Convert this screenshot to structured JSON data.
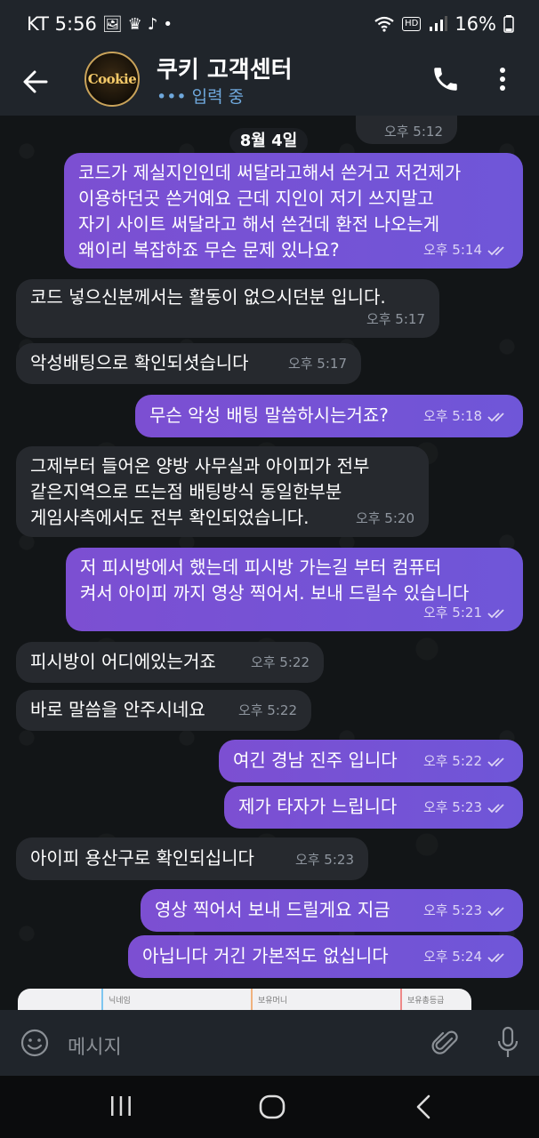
{
  "status_bar": {
    "carrier_time": "KT 5:56",
    "hd": "HD",
    "battery": "16%"
  },
  "header": {
    "avatar_text": "Cookie",
    "title": "쿠키 고객센터",
    "subtitle": "••• 입력 중"
  },
  "chat": {
    "prev_time": "오후 5:12",
    "date": "8월 4일",
    "messages": [
      {
        "dir": "out",
        "text": "코드가 제실지인인데 써달라고해서 쓴거고 저건제가\n이용하던곳 쓴거예요 근데 지인이 저기 쓰지말고\n자기 사이트 써달라고 해서 쓴건데 환전 나오는게\n왜이리 복잡하죠 무슨 문제 있나요?",
        "time": "오후 5:14"
      },
      {
        "dir": "in",
        "text": "코드 넣으신분께서는 활동이 없으시던분 입니다.",
        "time": "오후 5:17"
      },
      {
        "dir": "in",
        "text": "악성배팅으로 확인되셧습니다",
        "time": "오후 5:17"
      },
      {
        "dir": "out",
        "text": "무슨 악성 배팅 말씀하시는거죠?",
        "time": "오후 5:18"
      },
      {
        "dir": "in",
        "text": "그제부터 들어온 양방 사무실과 아이피가 전부\n같은지역으로 뜨는점 배팅방식 동일한부분\n게임사측에서도 전부 확인되었습니다.",
        "time": "오후 5:20"
      },
      {
        "dir": "out",
        "text": "저 피시방에서 했는데 피시방 가는길 부터 컴퓨터\n켜서 아이피 까지 영상 찍어서. 보내 드릴수 있습니다",
        "time": "오후 5:21"
      },
      {
        "dir": "in",
        "text": "피시방이 어디에있는거죠",
        "time": "오후 5:22"
      },
      {
        "dir": "in",
        "text": "바로 말씀을 안주시네요",
        "time": "오후 5:22"
      },
      {
        "dir": "out",
        "text": "여긴 경남 진주 입니다",
        "time": "오후 5:22"
      },
      {
        "dir": "out",
        "text": "제가 타자가 느립니다",
        "time": "오후 5:23"
      },
      {
        "dir": "in",
        "text": "아이피 용산구로 확인되십니다",
        "time": "오후 5:23"
      },
      {
        "dir": "out",
        "text": "영상 찍어서 보내 드릴게요 지금",
        "time": "오후 5:23"
      },
      {
        "dir": "out",
        "text": "아닙니다 거긴 가본적도 없십니다",
        "time": "오후 5:24"
      }
    ],
    "preview_labels": [
      "닉네임",
      "보유머니",
      "보유총등급"
    ]
  },
  "input": {
    "placeholder": "메시지"
  },
  "colors": {
    "outgoing_bubble": "#7a4fd0",
    "incoming_bubble": "#26292e",
    "bar_bg": "#20252b",
    "accent_blue": "#6fa8dc"
  }
}
